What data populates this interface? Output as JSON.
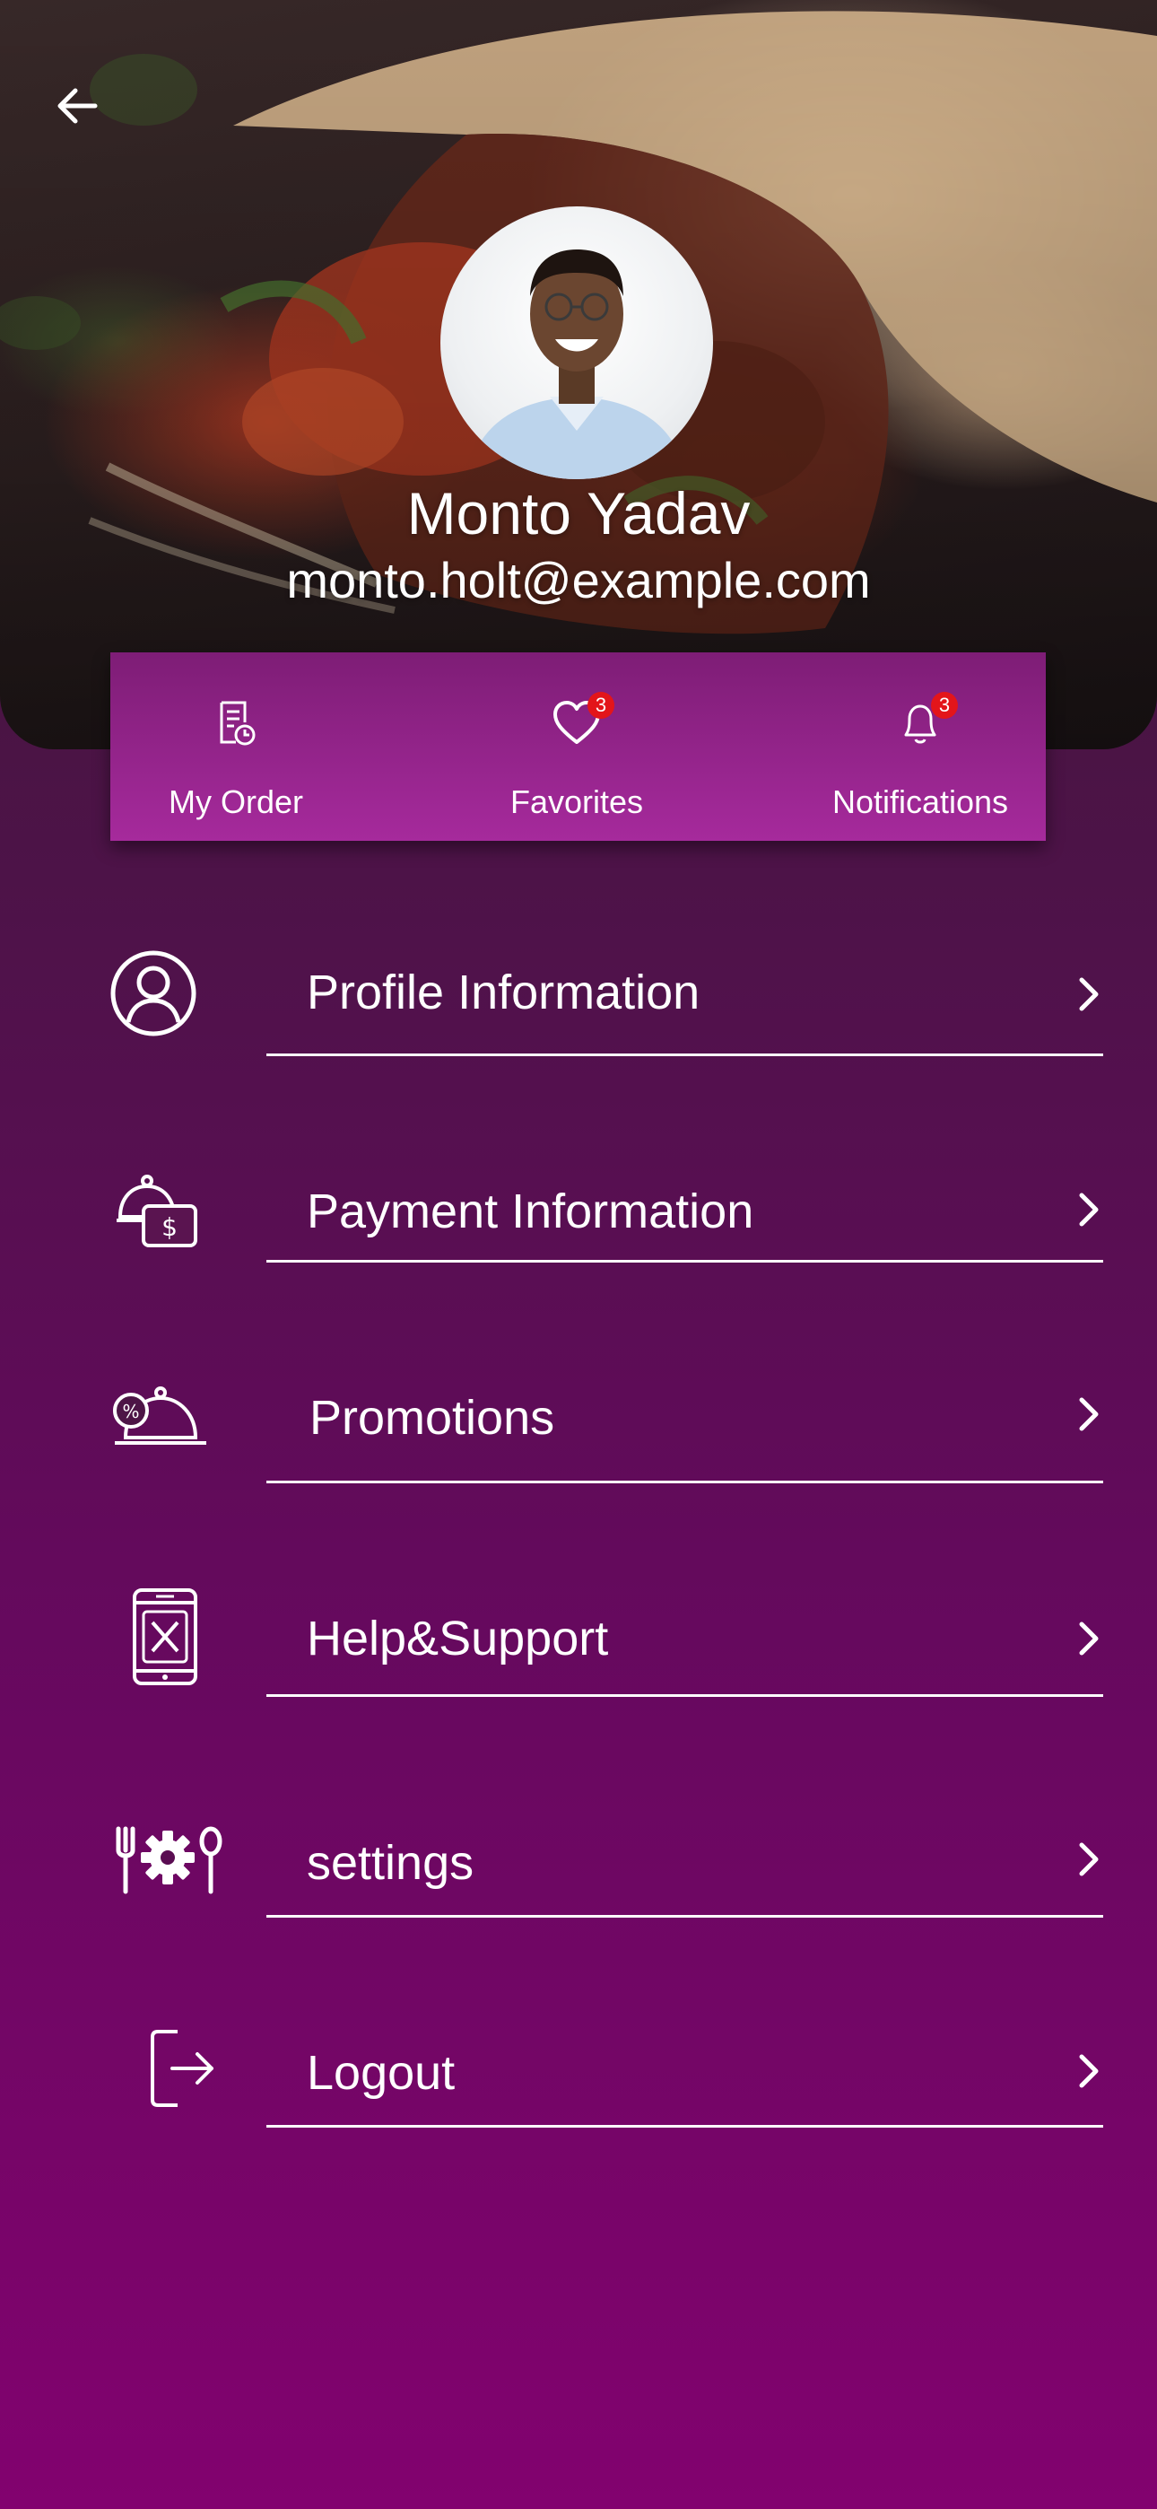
{
  "header": {
    "back_icon": "arrow-left-icon"
  },
  "profile": {
    "name": "Monto Yadav",
    "email": "monto.holt@example.com"
  },
  "quick_actions": [
    {
      "label": "My Order",
      "icon": "order-receipt-icon",
      "badge": ""
    },
    {
      "label": "Favorites",
      "icon": "heart-icon",
      "badge": "3"
    },
    {
      "label": "Notifications",
      "icon": "bell-icon",
      "badge": "3"
    }
  ],
  "menu": [
    {
      "label": "Profile Information",
      "icon": "user-circle-icon"
    },
    {
      "label": "Payment Information",
      "icon": "cloche-payment-icon"
    },
    {
      "label": "Promotions",
      "icon": "cloche-discount-icon"
    },
    {
      "label": "Help&Support",
      "icon": "phone-support-icon"
    },
    {
      "label": "settings",
      "icon": "utensils-gear-icon"
    },
    {
      "label": "Logout",
      "icon": "logout-icon"
    }
  ],
  "colors": {
    "background_top": "#3e1833",
    "background_bottom": "#82026f",
    "quickbar_top": "#7e1d76",
    "quickbar_bottom": "#a62a9c",
    "badge": "#e3151a",
    "text": "#ffffff"
  }
}
